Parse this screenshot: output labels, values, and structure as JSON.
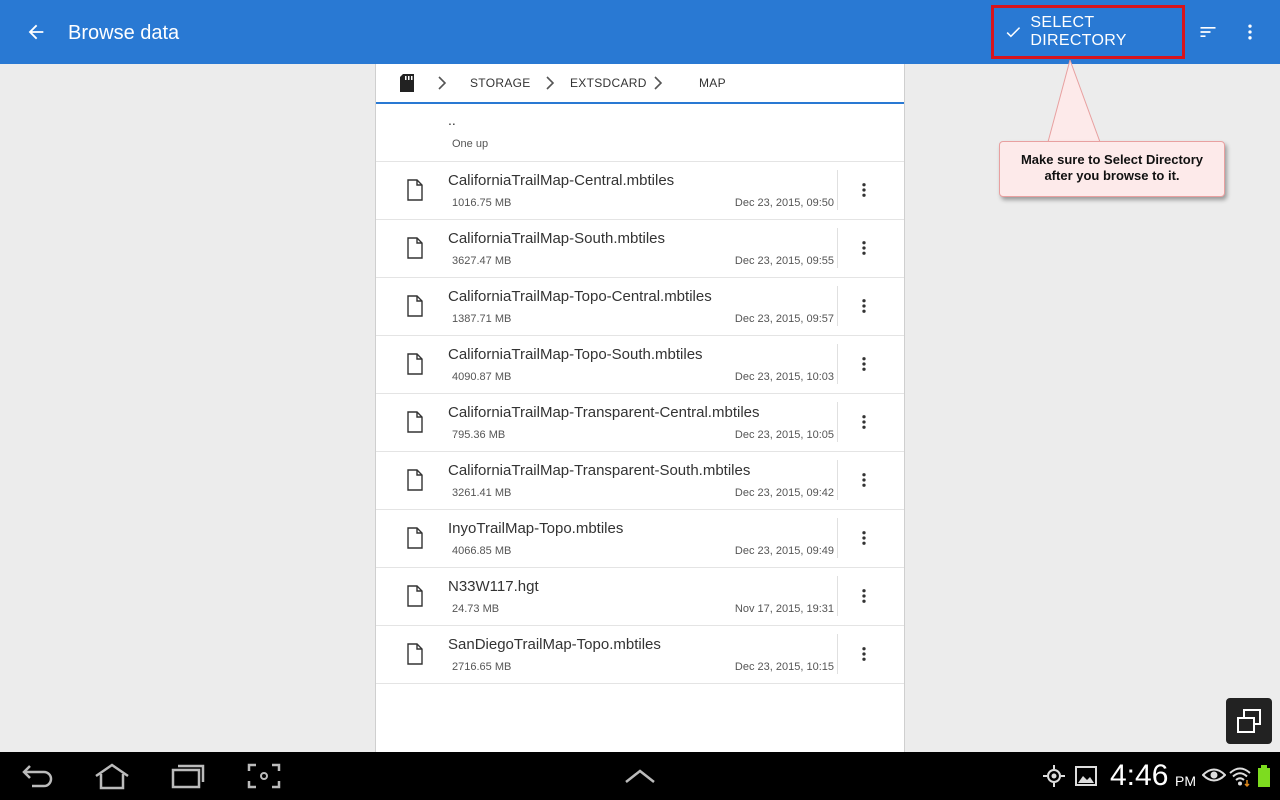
{
  "appbar": {
    "title": "Browse data",
    "select_directory": "SELECT DIRECTORY"
  },
  "breadcrumb": {
    "items": [
      "STORAGE",
      "EXTSDCARD",
      "MAP"
    ]
  },
  "up_item": {
    "name": "..",
    "label": "One up"
  },
  "files": [
    {
      "name": "CaliforniaTrailMap-Central.mbtiles",
      "size": "1016.75 MB",
      "date": "Dec 23, 2015, 09:50"
    },
    {
      "name": "CaliforniaTrailMap-South.mbtiles",
      "size": "3627.47 MB",
      "date": "Dec 23, 2015, 09:55"
    },
    {
      "name": "CaliforniaTrailMap-Topo-Central.mbtiles",
      "size": "1387.71 MB",
      "date": "Dec 23, 2015, 09:57"
    },
    {
      "name": "CaliforniaTrailMap-Topo-South.mbtiles",
      "size": "4090.87 MB",
      "date": "Dec 23, 2015, 10:03"
    },
    {
      "name": "CaliforniaTrailMap-Transparent-Central.mbtiles",
      "size": "795.36 MB",
      "date": "Dec 23, 2015, 10:05"
    },
    {
      "name": "CaliforniaTrailMap-Transparent-South.mbtiles",
      "size": "3261.41 MB",
      "date": "Dec 23, 2015, 09:42"
    },
    {
      "name": "InyoTrailMap-Topo.mbtiles",
      "size": "4066.85 MB",
      "date": "Dec 23, 2015, 09:49"
    },
    {
      "name": "N33W117.hgt",
      "size": "24.73 MB",
      "date": "Nov 17, 2015, 19:31"
    },
    {
      "name": "SanDiegoTrailMap-Topo.mbtiles",
      "size": "2716.65 MB",
      "date": "Dec 23, 2015, 10:15"
    }
  ],
  "callout": {
    "line1": "Make sure to Select Directory",
    "line2": "after you browse to it."
  },
  "status": {
    "time": "4:46",
    "ampm": "PM"
  },
  "colors": {
    "appbar": "#2979d3",
    "highlight": "#d8141c",
    "battery": "#7ddc1f"
  }
}
